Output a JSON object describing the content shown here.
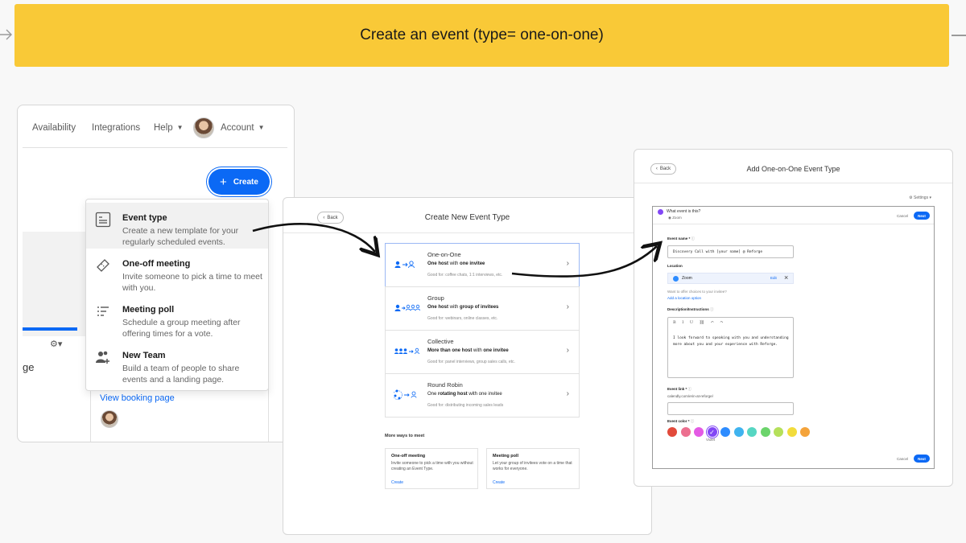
{
  "banner": {
    "title": "Create an event (type= one-on-one)"
  },
  "card1": {
    "nav": {
      "availability": "Availability",
      "integrations": "Integrations",
      "help": "Help",
      "account": "Account"
    },
    "create_label": "Create",
    "fragment_text": "ge",
    "view_booking": "View booking page",
    "dropdown": [
      {
        "title": "Event type",
        "desc": "Create a new template for your regularly scheduled events.",
        "icon": "template-icon"
      },
      {
        "title": "One-off meeting",
        "desc": "Invite someone to pick a time to meet with you.",
        "icon": "ticket-icon"
      },
      {
        "title": "Meeting poll",
        "desc": "Schedule a group meeting after offering times for a vote.",
        "icon": "poll-icon"
      },
      {
        "title": "New Team",
        "desc": "Build a team of people to share events and a landing page.",
        "icon": "team-add-icon"
      }
    ]
  },
  "card2": {
    "back": "Back",
    "title": "Create New Event Type",
    "types": [
      {
        "name": "One-on-One",
        "desc_bold": "One host",
        "desc_mid": " with ",
        "desc_bold2": "one invitee",
        "good": "Good for: coffee chats, 1:1 interviews, etc."
      },
      {
        "name": "Group",
        "desc_bold": "One host",
        "desc_mid": " with ",
        "desc_bold2": "group of invitees",
        "good": "Good for: webinars, online classes, etc."
      },
      {
        "name": "Collective",
        "desc_bold": "More than one host",
        "desc_mid": " with ",
        "desc_bold2": "one invitee",
        "good": "Good for: panel interviews, group sales calls, etc."
      },
      {
        "name": "Round Robin",
        "desc_bold": "One",
        "desc_mid": " rotating host ",
        "desc_bold2": "with one invitee",
        "good": "Good for: distributing incoming sales leads"
      }
    ],
    "more_title": "More ways to meet",
    "more": [
      {
        "title": "One-off meeting",
        "desc": "Invite someone to pick a time with you without creating an Event Type.",
        "link": "Create"
      },
      {
        "title": "Meeting poll",
        "desc": "Let your group of invitees vote on a time that works for everyone.",
        "link": "Create"
      }
    ]
  },
  "card3": {
    "back": "Back",
    "title": "Add One-on-One Event Type",
    "settings": "Settings",
    "question": "What event is this?",
    "zoom_sub": "Zoom",
    "cancel": "Cancel",
    "next": "Next",
    "event_name_label": "Event name *",
    "event_name_value": "Discovery Call with [your name] @ Reforge",
    "location_label": "Location",
    "location_value": "Zoom",
    "location_edit": "Edit",
    "location_hint": "Want to offer choices to your invitee?",
    "add_location": "Add a location option",
    "desc_label": "Description/Instructions",
    "toolbar": "B I U ⛓ ↶ ↷",
    "desc_text": "I look forward to speaking with you and understanding more about you and your experience with Reforge.",
    "link_label": "Event link *",
    "link_prefix": "calendly.com/erin-at-reforge/",
    "color_label": "Event color *",
    "selected_color_label": "Violet",
    "colors": [
      "#e24a3b",
      "#ec6f8f",
      "#e45ae4",
      "#8247f5",
      "#2d8cff",
      "#3fb3ef",
      "#56d6c2",
      "#6bd46b",
      "#b5e05a",
      "#f2dc3c",
      "#f4a33a"
    ]
  }
}
